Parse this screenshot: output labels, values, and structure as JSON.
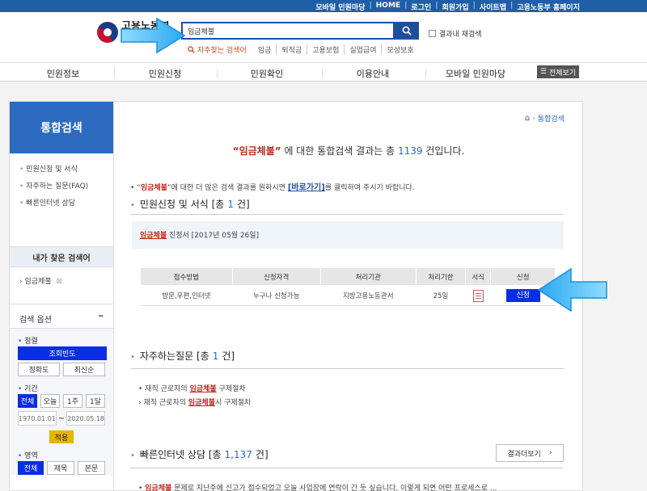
{
  "topbar": {
    "links": [
      "모바일 민원마당",
      "HOME",
      "로그인",
      "회원가입",
      "사이트맵",
      "고용노동부 홈페이지"
    ]
  },
  "header": {
    "logo_text": "고용노동부 민원마당",
    "search_value": "임금체불",
    "recheck_label": "결과내 재검색",
    "popular_label": "자주찾는 검색어",
    "popular_keywords": [
      "임금",
      "퇴직금",
      "고용보험",
      "실업급여",
      "모성보호"
    ]
  },
  "gnb": {
    "items": [
      "민원정보",
      "민원신청",
      "민원확인",
      "이용안내",
      "모바일 민원마당"
    ],
    "all_view": "전체보기"
  },
  "sidebar": {
    "title": "통합검색",
    "menu": [
      "민원신청 및 서식",
      "자주하는 질문(FAQ)",
      "빠른인터넷 상담"
    ],
    "my_keywords_title": "내가 찾은 검색어",
    "my_keyword": "임금체불",
    "options_title": "검색 옵션",
    "sort_label": "정렬",
    "sort_selected": "조회빈도",
    "sort_accuracy": "정확도",
    "sort_latest": "최신순",
    "period_label": "기간",
    "period_buttons": [
      "전체",
      "오늘",
      "1주",
      "1달"
    ],
    "date_from": "1970.01.01",
    "date_to": "2020.05.18",
    "date_tilde": "~",
    "apply": "적용",
    "area_label": "영역",
    "area_buttons": [
      "전체",
      "제목",
      "본문"
    ]
  },
  "main": {
    "breadcrumb": "통합검색",
    "summary_query": "“임금체불”",
    "summary_mid": " 에 대한 통합검색 결과는 총 ",
    "summary_count": "1139",
    "summary_end": " 건입니다.",
    "notice_pre": "• “",
    "notice_query": "임금체불",
    "notice_mid": "”에 대한 더 많은 검색 결과를 원하시면 ",
    "notice_go": "[바로가기]",
    "notice_end": "를 클릭하여 주시기 바랍니다.",
    "sec1_title": "민원신청 및 서식 [총",
    "sec1_count": "1",
    "sec1_end": "건]",
    "result_link": "임금체불",
    "result_text": " 진정서 [2017년 05월 26일]",
    "table_headers": [
      "접수방법",
      "신청자격",
      "처리기관",
      "처리기한",
      "서식",
      "신청"
    ],
    "table_row": [
      "방문,우편,인터넷",
      "누구나 신청가능",
      "지방고용노동관서",
      "25일"
    ],
    "apply_btn": "신청",
    "sec2_title": "자주하는질문 [총",
    "sec2_count": "1",
    "sec2_end": "건]",
    "faq1_pre": "• 재직 근로자의 ",
    "faq1_link": "임금체불",
    "faq1_end": " 구제절차",
    "faq2_pre": "› 재직 근로자의 ",
    "faq2_link": "임금체불",
    "faq2_end": "시 구제절차",
    "sec3_title": "빠른인터넷 상담 [총",
    "sec3_count": "1,137",
    "sec3_end": "건]",
    "more_btn": "결과더보기",
    "bottom_link": "임금체불",
    "bottom_text": " 문제로 지난주에 신고가 접수되었고 오늘 사업장에 연락이 간 듯 싶습니다. 이렇게 되면 어떤 프로세스로 ..."
  }
}
